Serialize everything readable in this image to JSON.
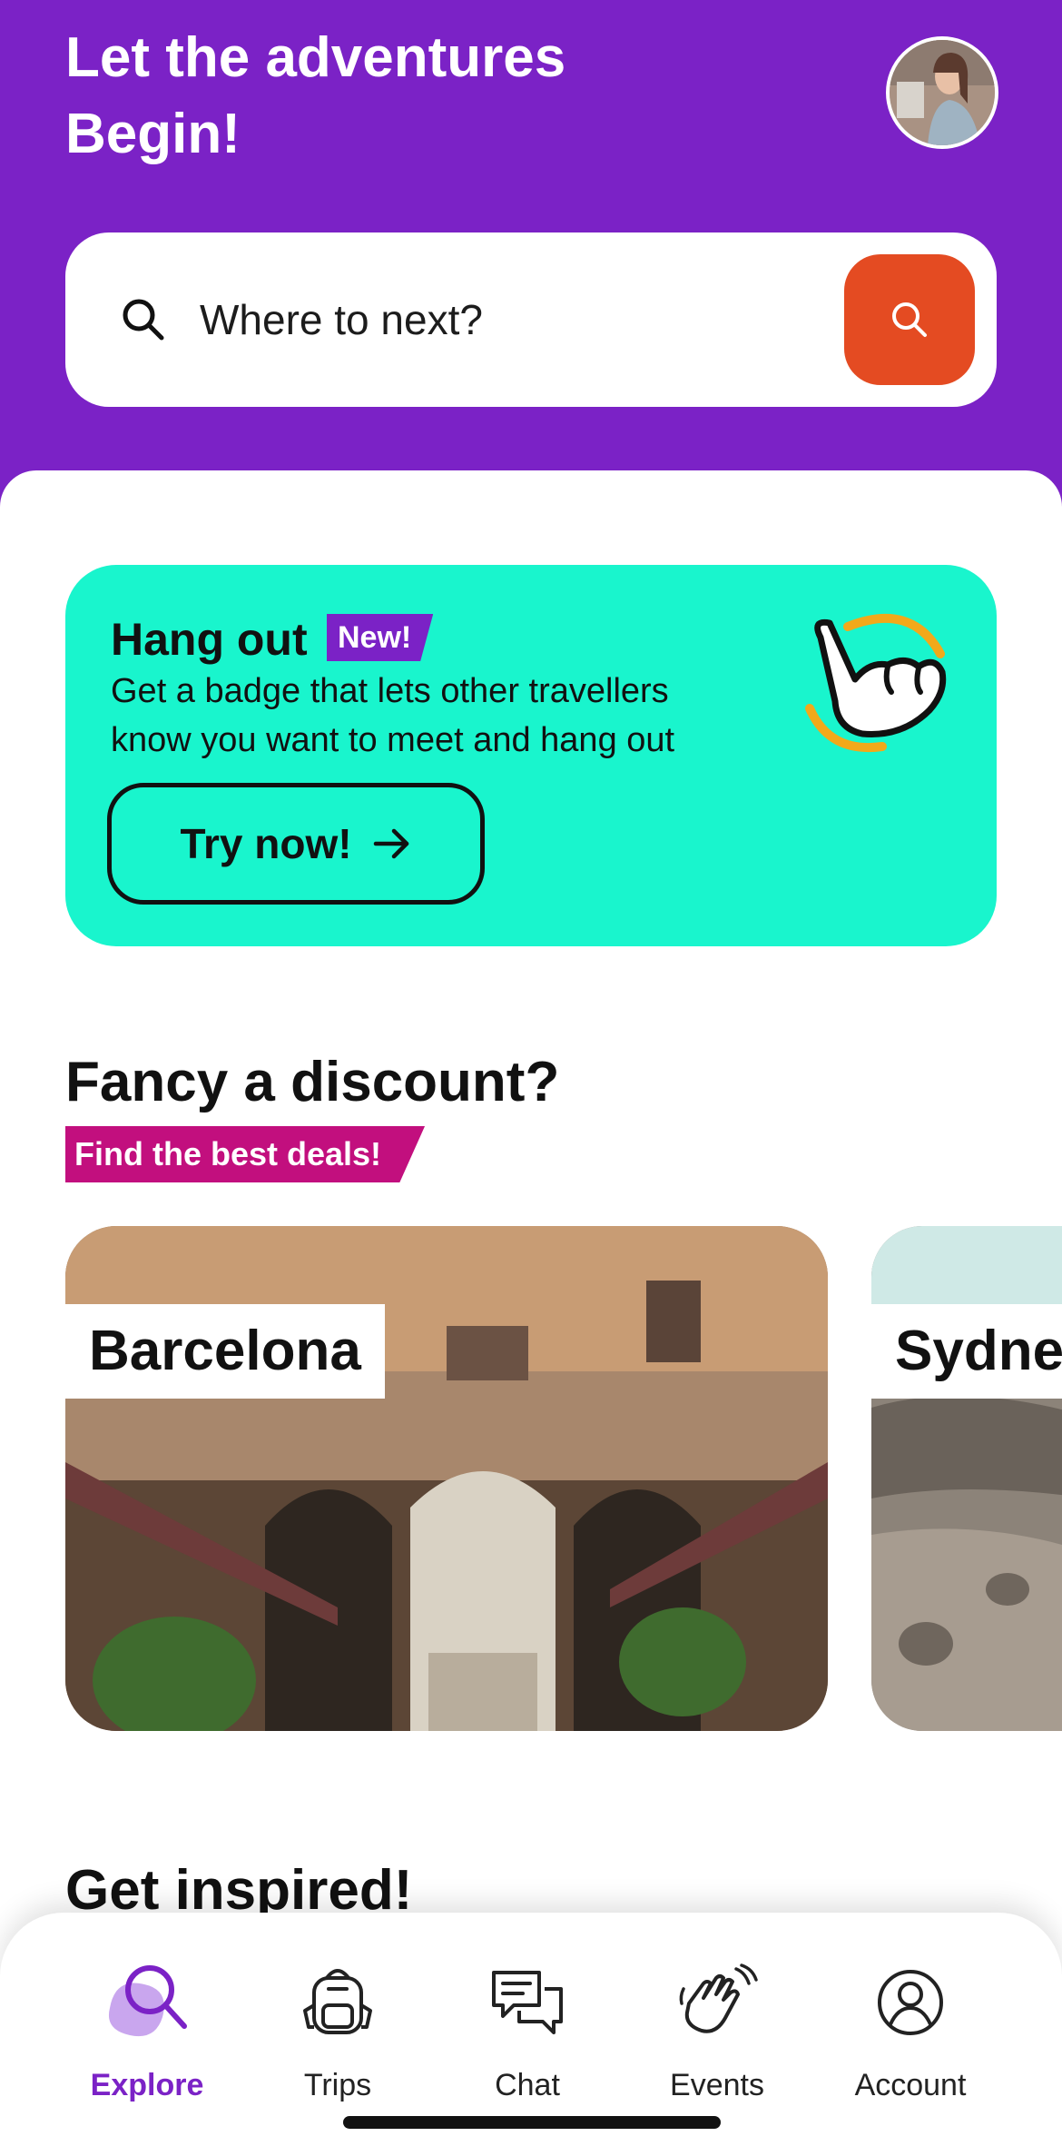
{
  "header": {
    "greeting_line1": "Let the adventures",
    "greeting_line2": "Begin!"
  },
  "search": {
    "placeholder": "Where to next?"
  },
  "promo": {
    "title": "Hang out",
    "badge": "New!",
    "description_line1": "Get a badge that lets other travellers",
    "description_line2": "know you want to meet and hang out",
    "cta_label": "Try now!"
  },
  "discount_section": {
    "title": "Fancy a discount?",
    "tag": "Find the best deals!",
    "cities": [
      {
        "name": "Barcelona"
      },
      {
        "name": "Sydne"
      }
    ]
  },
  "inspired_section": {
    "title": "Get inspired!"
  },
  "tabbar": {
    "items": [
      {
        "label": "Explore",
        "icon": "explore-search-icon",
        "active": true
      },
      {
        "label": "Trips",
        "icon": "backpack-icon",
        "active": false
      },
      {
        "label": "Chat",
        "icon": "chat-bubbles-icon",
        "active": false
      },
      {
        "label": "Events",
        "icon": "waving-hands-icon",
        "active": false
      },
      {
        "label": "Account",
        "icon": "account-icon",
        "active": false
      }
    ]
  },
  "colors": {
    "brand_purple": "#7B22C6",
    "search_button": "#E44B22",
    "promo_bg": "#19F5CD",
    "deals_tag": "#C20F7E"
  }
}
